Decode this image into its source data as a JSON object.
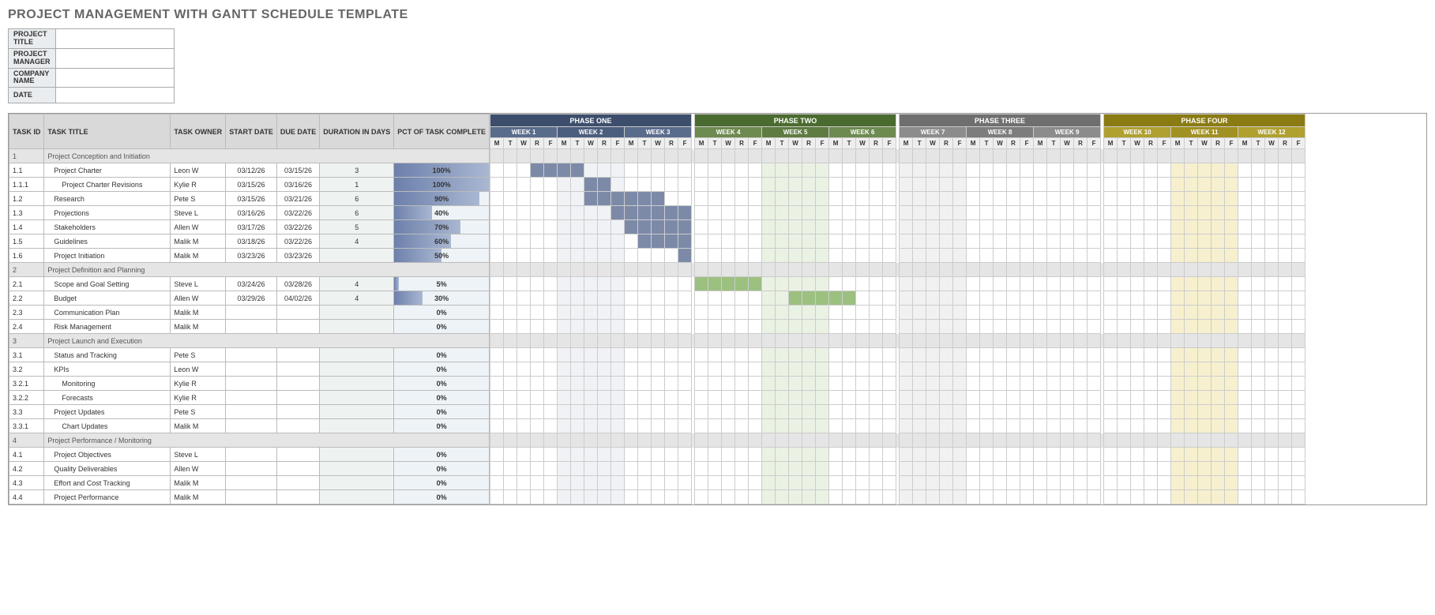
{
  "title": "PROJECT MANAGEMENT WITH GANTT SCHEDULE TEMPLATE",
  "meta": {
    "rows": [
      {
        "label": "PROJECT TITLE",
        "value": ""
      },
      {
        "label": "PROJECT MANAGER",
        "value": ""
      },
      {
        "label": "COMPANY NAME",
        "value": ""
      },
      {
        "label": "DATE",
        "value": ""
      }
    ]
  },
  "columns": {
    "task_id": "TASK ID",
    "task_title": "TASK TITLE",
    "task_owner": "TASK OWNER",
    "start_date": "START DATE",
    "due_date": "DUE DATE",
    "duration": "DURATION IN DAYS",
    "pct": "PCT OF TASK COMPLETE"
  },
  "phases": [
    {
      "label": "PHASE ONE",
      "class": "ph1",
      "weekClass": [
        "wk1",
        "wk1b"
      ],
      "shade": "shade1",
      "barClass": "bar1",
      "weeks": [
        "WEEK 1",
        "WEEK 2",
        "WEEK 3"
      ]
    },
    {
      "label": "PHASE TWO",
      "class": "ph2",
      "weekClass": [
        "wk2",
        "wk2b"
      ],
      "shade": "shade2",
      "barClass": "bar2",
      "weeks": [
        "WEEK 4",
        "WEEK 5",
        "WEEK 6"
      ]
    },
    {
      "label": "PHASE THREE",
      "class": "ph3",
      "weekClass": [
        "wk3",
        "wk3b"
      ],
      "shade": "shade3",
      "barClass": "",
      "weeks": [
        "WEEK 7",
        "WEEK 8",
        "WEEK 9"
      ]
    },
    {
      "label": "PHASE FOUR",
      "class": "ph4",
      "weekClass": [
        "wk4",
        "wk4b"
      ],
      "shade": "shade4",
      "barClass": "",
      "weeks": [
        "WEEK 10",
        "WEEK 11",
        "WEEK 12"
      ]
    }
  ],
  "days": [
    "M",
    "T",
    "W",
    "R",
    "F"
  ],
  "shadedWeeks": {
    "1": [
      1
    ],
    "2": [
      1
    ],
    "3": [
      0
    ],
    "4": [
      1
    ]
  },
  "tasks": [
    {
      "id": "1",
      "title": "Project Conception and Initiation",
      "section": true
    },
    {
      "id": "1.1",
      "title": "Project Charter",
      "owner": "Leon W",
      "start": "03/12/26",
      "due": "03/15/26",
      "dur": "3",
      "pct": 100,
      "barStart": 3,
      "barLen": 4,
      "barClass": "bar1",
      "indent": 1
    },
    {
      "id": "1.1.1",
      "title": "Project Charter Revisions",
      "owner": "Kylie R",
      "start": "03/15/26",
      "due": "03/16/26",
      "dur": "1",
      "pct": 100,
      "barStart": 7,
      "barLen": 2,
      "barClass": "bar1",
      "indent": 2
    },
    {
      "id": "1.2",
      "title": "Research",
      "owner": "Pete S",
      "start": "03/15/26",
      "due": "03/21/26",
      "dur": "6",
      "pct": 90,
      "barStart": 7,
      "barLen": 6,
      "barClass": "bar1",
      "indent": 1
    },
    {
      "id": "1.3",
      "title": "Projections",
      "owner": "Steve L",
      "start": "03/16/26",
      "due": "03/22/26",
      "dur": "6",
      "pct": 40,
      "barStart": 9,
      "barLen": 6,
      "barClass": "bar1",
      "indent": 1
    },
    {
      "id": "1.4",
      "title": "Stakeholders",
      "owner": "Allen W",
      "start": "03/17/26",
      "due": "03/22/26",
      "dur": "5",
      "pct": 70,
      "barStart": 10,
      "barLen": 5,
      "barClass": "bar1",
      "indent": 1
    },
    {
      "id": "1.5",
      "title": "Guidelines",
      "owner": "Malik M",
      "start": "03/18/26",
      "due": "03/22/26",
      "dur": "4",
      "pct": 60,
      "barStart": 11,
      "barLen": 4,
      "barClass": "bar1",
      "indent": 1
    },
    {
      "id": "1.6",
      "title": "Project Initiation",
      "owner": "Malik M",
      "start": "03/23/26",
      "due": "03/23/26",
      "dur": "",
      "pct": 50,
      "barStart": 14,
      "barLen": 1,
      "barClass": "bar1",
      "indent": 1
    },
    {
      "id": "2",
      "title": "Project Definition and Planning",
      "section": true
    },
    {
      "id": "2.1",
      "title": "Scope and Goal Setting",
      "owner": "Steve L",
      "start": "03/24/26",
      "due": "03/28/26",
      "dur": "4",
      "pct": 5,
      "barStart": 15,
      "barLen": 5,
      "barClass": "bar2",
      "indent": 1
    },
    {
      "id": "2.2",
      "title": "Budget",
      "owner": "Allen W",
      "start": "03/29/26",
      "due": "04/02/26",
      "dur": "4",
      "pct": 30,
      "barStart": 22,
      "barLen": 5,
      "barClass": "bar2",
      "indent": 1
    },
    {
      "id": "2.3",
      "title": "Communication Plan",
      "owner": "Malik M",
      "start": "",
      "due": "",
      "dur": "",
      "pct": 0,
      "indent": 1
    },
    {
      "id": "2.4",
      "title": "Risk Management",
      "owner": "Malik M",
      "start": "",
      "due": "",
      "dur": "",
      "pct": 0,
      "indent": 1
    },
    {
      "id": "3",
      "title": "Project Launch and Execution",
      "section": true
    },
    {
      "id": "3.1",
      "title": "Status and Tracking",
      "owner": "Pete S",
      "start": "",
      "due": "",
      "dur": "",
      "pct": 0,
      "indent": 1
    },
    {
      "id": "3.2",
      "title": "KPIs",
      "owner": "Leon W",
      "start": "",
      "due": "",
      "dur": "",
      "pct": 0,
      "indent": 1
    },
    {
      "id": "3.2.1",
      "title": "Monitoring",
      "owner": "Kylie R",
      "start": "",
      "due": "",
      "dur": "",
      "pct": 0,
      "indent": 2
    },
    {
      "id": "3.2.2",
      "title": "Forecasts",
      "owner": "Kylie R",
      "start": "",
      "due": "",
      "dur": "",
      "pct": 0,
      "indent": 2
    },
    {
      "id": "3.3",
      "title": "Project Updates",
      "owner": "Pete S",
      "start": "",
      "due": "",
      "dur": "",
      "pct": 0,
      "indent": 1
    },
    {
      "id": "3.3.1",
      "title": "Chart Updates",
      "owner": "Malik M",
      "start": "",
      "due": "",
      "dur": "",
      "pct": 0,
      "indent": 2
    },
    {
      "id": "4",
      "title": "Project Performance / Monitoring",
      "section": true
    },
    {
      "id": "4.1",
      "title": "Project Objectives",
      "owner": "Steve L",
      "start": "",
      "due": "",
      "dur": "",
      "pct": 0,
      "indent": 1
    },
    {
      "id": "4.2",
      "title": "Quality Deliverables",
      "owner": "Allen W",
      "start": "",
      "due": "",
      "dur": "",
      "pct": 0,
      "indent": 1
    },
    {
      "id": "4.3",
      "title": "Effort and Cost Tracking",
      "owner": "Malik M",
      "start": "",
      "due": "",
      "dur": "",
      "pct": 0,
      "indent": 1
    },
    {
      "id": "4.4",
      "title": "Project Performance",
      "owner": "Malik M",
      "start": "",
      "due": "",
      "dur": "",
      "pct": 0,
      "indent": 1
    }
  ]
}
